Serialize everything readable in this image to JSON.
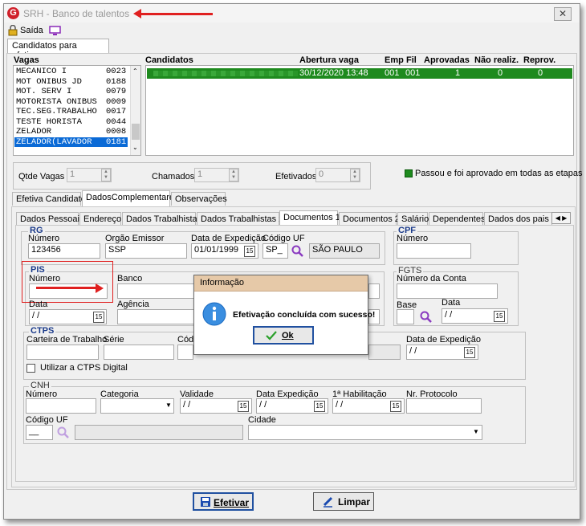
{
  "window": {
    "title": "SRH - Banco de talentos",
    "close_glyph": "✕"
  },
  "toolbar": {
    "exit_label": "Saída"
  },
  "main_tab": {
    "label": "Candidatos para efetivar"
  },
  "vagas": {
    "header": "Vagas",
    "items": [
      {
        "name": "MECANICO I",
        "code": "0023"
      },
      {
        "name": "MOT ONIBUS JD",
        "code": "0188"
      },
      {
        "name": "MOT. SERV I",
        "code": "0079"
      },
      {
        "name": "MOTORISTA ONIBUS",
        "code": "0009"
      },
      {
        "name": "TEC.SEG.TRABALHO",
        "code": "0017"
      },
      {
        "name": "TESTE HORISTA",
        "code": "0044"
      },
      {
        "name": "ZELADOR",
        "code": "0008"
      },
      {
        "name": "ZELADOR(LAVADOR",
        "code": "0181"
      }
    ],
    "selected_index": 7
  },
  "candidatos": {
    "headers": {
      "candidatos": "Candidatos",
      "abertura": "Abertura vaga",
      "emp": "Emp",
      "fil": "Fil",
      "aprovadas": "Aprovadas",
      "nao_realiz": "Não realiz.",
      "reprov": "Reprov."
    },
    "row": {
      "abertura": "30/12/2020 13:48",
      "emp": "001",
      "fil": "001",
      "aprovadas": "1",
      "nao_realiz": "0",
      "reprov": "0"
    },
    "row_color": "#1e8a1e"
  },
  "stats": {
    "qtde_vagas_label": "Qtde Vagas",
    "qtde_vagas": "1",
    "chamados_label": "Chamados",
    "chamados": "1",
    "efetivados_label": "Efetivados",
    "efetivados": "0",
    "legend": "Passou e foi aprovado em todas as etapas",
    "legend_color": "#1e8a1e"
  },
  "sub_tabs": [
    "Efetiva Candidato",
    "DadosComplementares",
    "Observações"
  ],
  "detail_tabs": [
    "Dados Pessoais",
    "Endereço",
    "Dados Trabalhistas",
    "Dados Trabalhistas 2",
    "Documentos 1",
    "Documentos 2",
    "Salário",
    "Dependentes",
    "Dados dos pais do"
  ],
  "rg": {
    "title": "RG",
    "numero_label": "Número",
    "numero": "123456",
    "orgao_label": "Orgão Emissor",
    "orgao": "SSP",
    "data_label": "Data de Expedição",
    "data": "01/01/1999",
    "uf_label": "Código UF",
    "uf": "SP_",
    "uf_name": "SÃO PAULO"
  },
  "cpf": {
    "title": "CPF",
    "numero_label": "Número",
    "numero": ""
  },
  "pis": {
    "title": "PIS",
    "numero_label": "Número",
    "numero": "",
    "banco_label": "Banco",
    "data_label": "Data",
    "data": " / /",
    "agencia_label": "Agência"
  },
  "fgts": {
    "title": "FGTS",
    "conta_label": "Número da Conta",
    "base_label": "Base",
    "data_label": "Data",
    "data": " / /"
  },
  "ctps": {
    "title": "CTPS",
    "carteira_label": "Carteira de Trabalho",
    "serie_label": "Série",
    "codigo_label": "Cód",
    "data_label": "Data de Expedição",
    "data": " / /",
    "digital_label": "Utilizar a CTPS Digital"
  },
  "cnh": {
    "title": "CNH",
    "numero_label": "Número",
    "categoria_label": "Categoria",
    "validade_label": "Validade",
    "validade": " / /",
    "data_exp_label": "Data Expedição",
    "data_exp": " / /",
    "primeira_label": "1ª Habilitação",
    "primeira": " / /",
    "protocolo_label": "Nr. Protocolo",
    "uf_label": "Código UF",
    "uf": "__",
    "cidade_label": "Cidade"
  },
  "dialog": {
    "title": "Informação",
    "message": "Efetivação concluída com sucesso!",
    "ok_label": "Ok"
  },
  "bottom": {
    "efetivar_label": "Efetivar",
    "limpar_label": "Limpar"
  }
}
